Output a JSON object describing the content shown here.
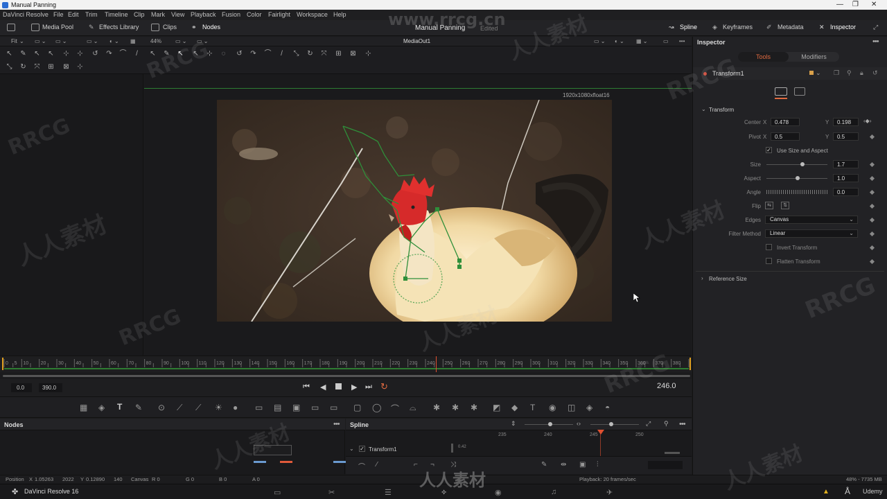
{
  "window": {
    "title": "Manual Panning"
  },
  "menu": [
    "DaVinci Resolve",
    "File",
    "Edit",
    "Trim",
    "Timeline",
    "Clip",
    "Mark",
    "View",
    "Playback",
    "Fusion",
    "Color",
    "Fairlight",
    "Workspace",
    "Help"
  ],
  "toolbar": {
    "media_pool": "Media Pool",
    "effects_library": "Effects Library",
    "clips": "Clips",
    "nodes": "Nodes",
    "project_title": "Manual Panning",
    "project_status": "Edited",
    "spline": "Spline",
    "keyframes": "Keyframes",
    "metadata": "Metadata",
    "inspector": "Inspector"
  },
  "viewer": {
    "fit": "Fit",
    "zoom": "44%",
    "name": "MediaOut1",
    "resolution": "1920x1080xfloat16"
  },
  "inspector": {
    "title": "Inspector",
    "tabs": [
      "Tools",
      "Modifiers"
    ],
    "node_name": "Transform1",
    "section": "Transform",
    "center_label": "Center",
    "center_x": "0.478",
    "center_y": "0.198",
    "pivot_label": "Pivot",
    "pivot_x": "0.5",
    "pivot_y": "0.5",
    "x_label": "X",
    "y_label": "Y",
    "use_size_aspect": "Use Size and Aspect",
    "size_label": "Size",
    "size": "1.7",
    "aspect_label": "Aspect",
    "aspect": "1.0",
    "angle_label": "Angle",
    "angle": "0.0",
    "flip_label": "Flip",
    "edges_label": "Edges",
    "edges": "Canvas",
    "filter_label": "Filter Method",
    "filter": "Linear",
    "invert_transform": "Invert Transform",
    "flatten_transform": "Flatten Transform",
    "reference_size": "Reference Size"
  },
  "timeline": {
    "ticks": [
      "0",
      "5",
      "10",
      "20",
      "30",
      "40",
      "50",
      "60",
      "70",
      "80",
      "90",
      "100",
      "110",
      "120",
      "130",
      "140",
      "150",
      "160",
      "170",
      "180",
      "190",
      "200",
      "210",
      "220",
      "230",
      "240",
      "250",
      "260",
      "270",
      "280",
      "290",
      "300",
      "310",
      "320",
      "330",
      "340",
      "350",
      "360",
      "370",
      "380"
    ],
    "start": "0.0",
    "end": "390.0",
    "current": "246.0",
    "playhead_frame": 246,
    "max_frame": 390
  },
  "nodes_panel": {
    "title": "Nodes"
  },
  "spline_panel": {
    "title": "Spline",
    "track": "Transform1",
    "ticks": [
      "235",
      "240",
      "245",
      "250"
    ],
    "value": "0.42"
  },
  "status": {
    "position_label": "Position",
    "x_label": "X",
    "x": "1.05263",
    "x2": "2022",
    "y_label": "Y",
    "y": "0.12890",
    "y2": "140",
    "canvas_label": "Canvas",
    "r": "R 0",
    "g": "G 0",
    "b": "B 0",
    "a": "A 0",
    "playback": "Playback: 20 frames/sec",
    "memory": "48% - 7735 MB"
  },
  "pagebar": {
    "app": "DaVinci Resolve 16",
    "udemy": "Udemy"
  },
  "watermarks": [
    "RRCG",
    "人人素材",
    "www.rrcg.cn"
  ],
  "colors": {
    "accent": "#e06a40",
    "roi": "#2e7d32",
    "playhead": "#e05030"
  }
}
